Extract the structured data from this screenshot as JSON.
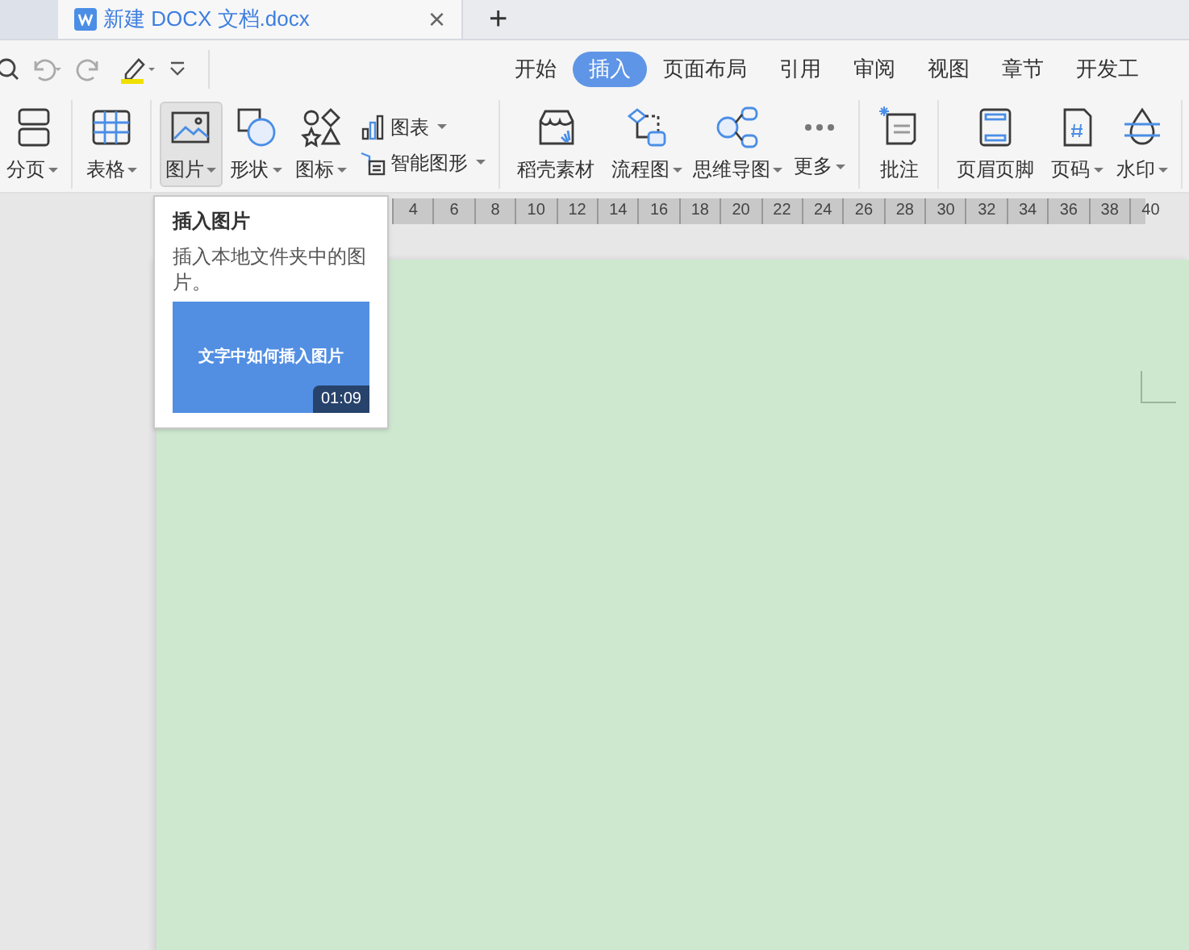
{
  "document_tab": {
    "title": "新建 DOCX 文档.docx",
    "close": "×",
    "new_tab": "+"
  },
  "menu_tabs": [
    {
      "label": "开始",
      "selected": false
    },
    {
      "label": "插入",
      "selected": true
    },
    {
      "label": "页面布局",
      "selected": false
    },
    {
      "label": "引用",
      "selected": false
    },
    {
      "label": "审阅",
      "selected": false
    },
    {
      "label": "视图",
      "selected": false
    },
    {
      "label": "章节",
      "selected": false
    },
    {
      "label": "开发工",
      "selected": false
    }
  ],
  "ribbon": [
    {
      "kind": "large",
      "label": "分页",
      "dropdown": true,
      "selected": false
    },
    {
      "kind": "sep"
    },
    {
      "kind": "large",
      "label": "表格",
      "dropdown": true,
      "selected": false
    },
    {
      "kind": "sep"
    },
    {
      "kind": "large",
      "label": "图片",
      "dropdown": true,
      "selected": true
    },
    {
      "kind": "large",
      "label": "形状",
      "dropdown": true,
      "selected": false
    },
    {
      "kind": "large",
      "label": "图标",
      "dropdown": true,
      "selected": false
    },
    {
      "kind": "stack",
      "items": [
        {
          "label": "图表",
          "dropdown": true
        },
        {
          "label": "智能图形",
          "dropdown": true
        }
      ]
    },
    {
      "kind": "sep"
    },
    {
      "kind": "large",
      "label": "稻壳素材",
      "dropdown": false,
      "selected": false
    },
    {
      "kind": "large",
      "label": "流程图",
      "dropdown": true,
      "selected": false
    },
    {
      "kind": "large",
      "label": "思维导图",
      "dropdown": true,
      "selected": false
    },
    {
      "kind": "large",
      "label": "更多",
      "dropdown": true,
      "selected": false
    },
    {
      "kind": "sep"
    },
    {
      "kind": "large",
      "label": "批注",
      "dropdown": false,
      "selected": false
    },
    {
      "kind": "sep"
    },
    {
      "kind": "large",
      "label": "页眉页脚",
      "dropdown": false,
      "selected": false
    },
    {
      "kind": "large",
      "label": "页码",
      "dropdown": true,
      "selected": false
    },
    {
      "kind": "large",
      "label": "水印",
      "dropdown": true,
      "selected": false
    },
    {
      "kind": "sep"
    }
  ],
  "ruler": [
    "4",
    "6",
    "8",
    "10",
    "12",
    "14",
    "16",
    "18",
    "20",
    "22",
    "24",
    "26",
    "28",
    "30",
    "32",
    "34",
    "36",
    "38",
    "40"
  ],
  "tooltip": {
    "title": "插入图片",
    "description": "插入本地文件夹中的图片。",
    "video": {
      "title": "文字中如何插入图片",
      "duration": "01:09"
    }
  }
}
